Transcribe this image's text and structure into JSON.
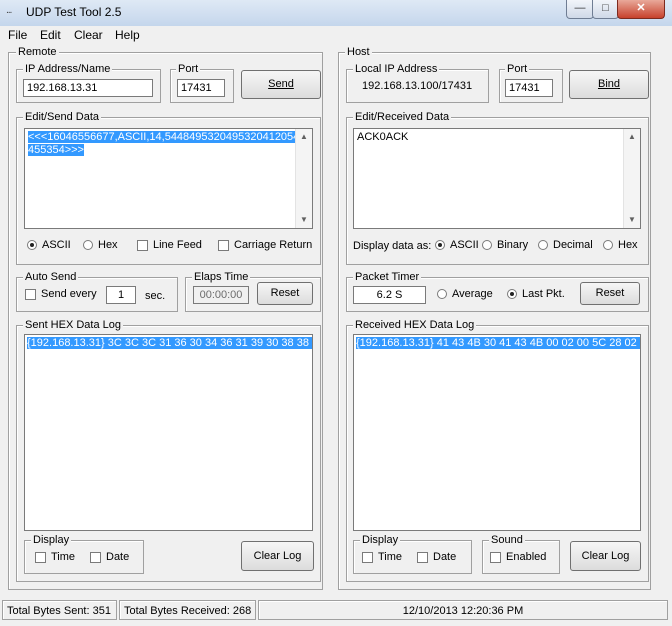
{
  "window": {
    "title": "UDP Test Tool 2.5",
    "min_glyph": "—",
    "max_glyph": "□",
    "close_glyph": "✕",
    "app_icon_glyph": "∙∙∙"
  },
  "menu": [
    "File",
    "Edit",
    "Clear",
    "Help"
  ],
  "remote": {
    "group_label": "Remote",
    "ip_label": "IP Address/Name",
    "ip_value": "192.168.13.31",
    "port_label": "Port",
    "port_value": "17431",
    "send_button": "Send",
    "edit_label": "Edit/Send Data",
    "send_data": "<<<16046556677,ASCII,14,54484953204953204120544553543​>>>",
    "send_data_line1": "<<<16046556677,ASCII,14,5448495320495320412054",
    "send_data_line2": "455354>>>",
    "format_options": [
      "ASCII",
      "Hex"
    ],
    "format_selected": "ASCII",
    "line_feed_label": "Line Feed",
    "carriage_return_label": "Carriage Return",
    "auto_send_label": "Auto Send",
    "send_every_label": "Send every",
    "send_every_value": "1",
    "sec_label": "sec.",
    "elaps_label": "Elaps Time",
    "elaps_value": "00:00:00",
    "reset_button": "Reset",
    "log_label": "Sent HEX Data Log",
    "log_line": "{192.168.13.31} 3C 3C 3C 31 36 30 34 36 31 39 30 38 38 3",
    "display_label": "Display",
    "time_label": "Time",
    "date_label": "Date",
    "clear_log_button": "Clear Log"
  },
  "host": {
    "group_label": "Host",
    "local_ip_label": "Local IP Address",
    "local_ip_value": "192.168.13.100/17431",
    "port_label": "Port",
    "port_value": "17431",
    "bind_button": "Bind",
    "received_label": "Edit/Received Data",
    "received_data": "ACK0ACK",
    "display_as_label": "Display data as:",
    "display_options": [
      "ASCII",
      "Binary",
      "Decimal",
      "Hex"
    ],
    "display_selected": "ASCII",
    "packet_timer_label": "Packet Timer",
    "packet_timer_value": "6.2 S",
    "timer_options": [
      "Average",
      "Last Pkt."
    ],
    "timer_selected": "Last Pkt.",
    "reset_button": "Reset",
    "log_label": "Received HEX Data Log",
    "log_line": "{192.168.13.31} 41 43 4B 30 41 43 4B 00 02 00 5C 28 02 0",
    "display_label": "Display",
    "time_label": "Time",
    "date_label": "Date",
    "sound_label": "Sound",
    "enabled_label": "Enabled",
    "clear_log_button": "Clear Log"
  },
  "status": {
    "sent": "Total Bytes Sent: 351",
    "received": "Total Bytes Received: 268",
    "datetime": "12/10/2013 12:20:36 PM"
  }
}
